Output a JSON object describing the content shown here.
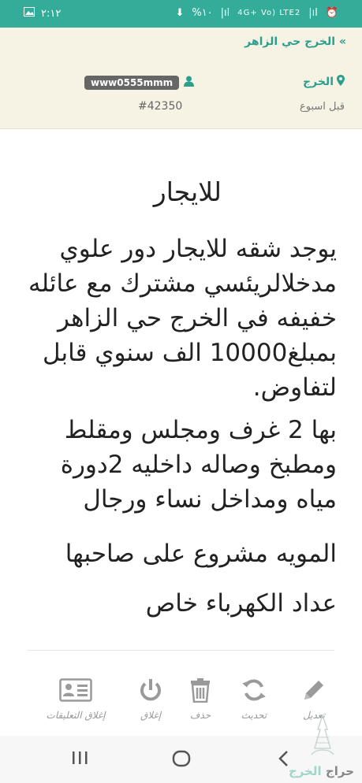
{
  "status_bar": {
    "time": "٢:١٢",
    "battery": "%١٠",
    "network": "4G+ Vo) LTE2"
  },
  "header": {
    "breadcrumb": "» الخرج حي الزاهر",
    "city": "الخرج",
    "time_ago": "قبل اسبوع",
    "username": "www0555mmm",
    "ad_id": "#42350"
  },
  "post": {
    "title": "للايجار",
    "paragraph1": "يوجد شقه للايجار دور علوي مدخلالريئسي مشترك  مع عائله خفيفه في الخرج حي الزاهر بمبلغ10000 الف سنوي قابل لتفاوض.",
    "paragraph2": "بها 2 غرف ومجلس ومقلط ومطبخ وصاله داخليه 2دورة مياه ومداخل نساء ورجال",
    "paragraph3": "المويه مشروع على صاحبها",
    "paragraph4": "عداد الكهرباء خاص"
  },
  "actions": {
    "edit": "تعديل",
    "refresh": "تحديث",
    "delete": "حذف",
    "close": "إغلاق",
    "close_comments": "إغلاق التعليقات"
  },
  "brand": {
    "part1": "حراج",
    "part2": "الخرج"
  },
  "colors": {
    "accent": "#33ad9a",
    "header_bg": "#f6f3e4"
  }
}
